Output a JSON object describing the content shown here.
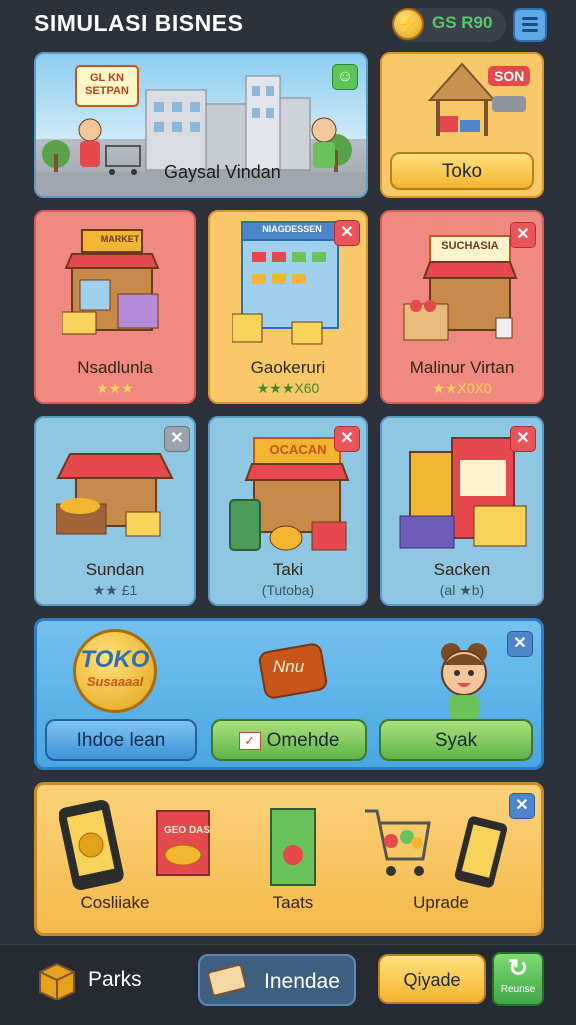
{
  "header": {
    "title": "SIMULASI BISNES",
    "coin_glyph": "⚡",
    "currency": "GS R90"
  },
  "banner": {
    "sign": "GL KN SETPAN",
    "label": "Gaysal Vindan"
  },
  "toko_card": {
    "badge": "SON",
    "button": "Toko"
  },
  "shops_row1": [
    {
      "name": "Nsadlunla",
      "rating": "★★★",
      "sign": "MARKET"
    },
    {
      "name": "Gaokeruri",
      "rating": "★★★X60",
      "sign": "NIAGDESSEN"
    },
    {
      "name": "Malinur Virtan",
      "rating": "★★X0X0",
      "sign": "SUCHASIA"
    }
  ],
  "shops_row2": [
    {
      "name": "Sundan",
      "rating": "★★ £1"
    },
    {
      "name": "Taki",
      "rating": "(Tutoba)",
      "sign": "OCACAN"
    },
    {
      "name": "Sacken",
      "rating": "(al ★b)"
    }
  ],
  "promo": {
    "logo_top": "TOKO",
    "logo_bottom": "Susaaaal",
    "speech": "Nnu",
    "buttons": [
      "Ihdoe lean",
      "Omehde",
      "Syak"
    ]
  },
  "items": [
    {
      "label": "Cosliiake",
      "icon": "phone-icon"
    },
    {
      "label": "",
      "icon": "snack-box-icon",
      "box_text": "GEO DAS"
    },
    {
      "label": "Taats",
      "icon": "juice-box-icon"
    },
    {
      "label": "Uprade",
      "icon": "cart-icon"
    },
    {
      "label": "",
      "icon": "phone-icon"
    }
  ],
  "bottom_bar": {
    "parks": "Parks",
    "inendae": "Inendae",
    "qiade": "Qiyade",
    "reunse": "Reunse"
  },
  "colors": {
    "background": "#2c313a",
    "red_card": "#f08a80",
    "orange_card": "#f8c869",
    "blue_card": "#8fc6e2",
    "accent_green": "#58c865"
  }
}
